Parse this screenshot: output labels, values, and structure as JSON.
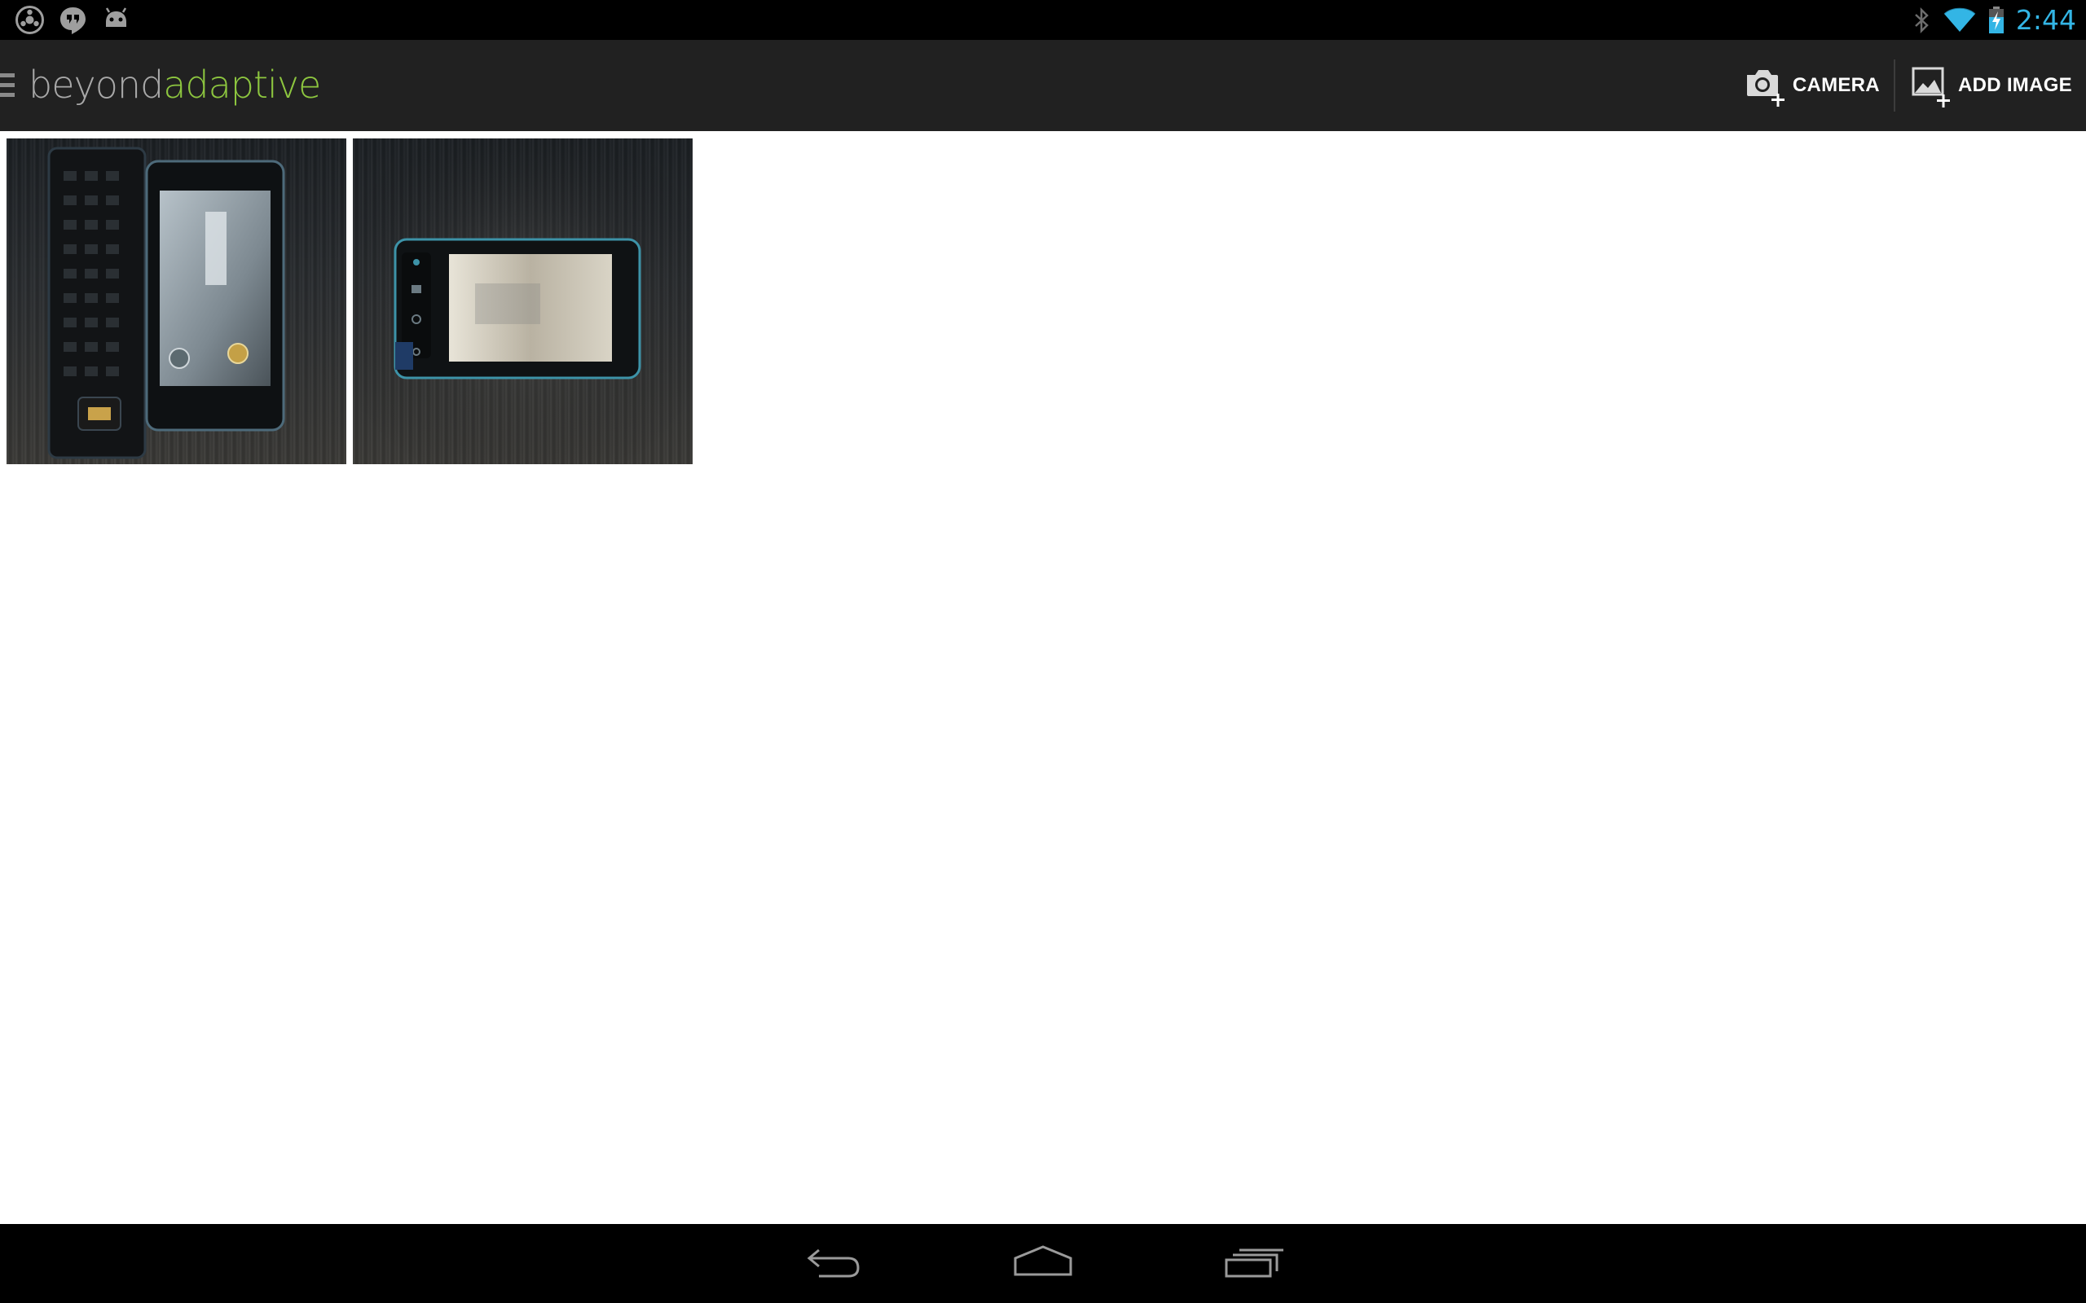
{
  "status_bar": {
    "time": "2:44",
    "notification_icons": [
      "chrome-icon",
      "hangouts-icon",
      "android-icon"
    ],
    "system_icons": [
      "bluetooth-icon",
      "wifi-icon",
      "battery-charging-icon"
    ],
    "accent_color": "#33b5e5"
  },
  "action_bar": {
    "brand": {
      "part1": "beyond",
      "part2": "adaptive",
      "part1_color": "#a8a8a8",
      "part2_color": "#8dc63f"
    },
    "actions": [
      {
        "icon": "camera-add-icon",
        "label": "CAMERA"
      },
      {
        "icon": "image-add-icon",
        "label": "ADD IMAGE"
      }
    ]
  },
  "gallery": {
    "images": [
      {
        "subject": "phone-keyboard-open-photo"
      },
      {
        "subject": "phone-closed-photo"
      }
    ]
  },
  "nav_bar": {
    "buttons": [
      "back-icon",
      "home-icon",
      "recent-apps-icon"
    ]
  }
}
